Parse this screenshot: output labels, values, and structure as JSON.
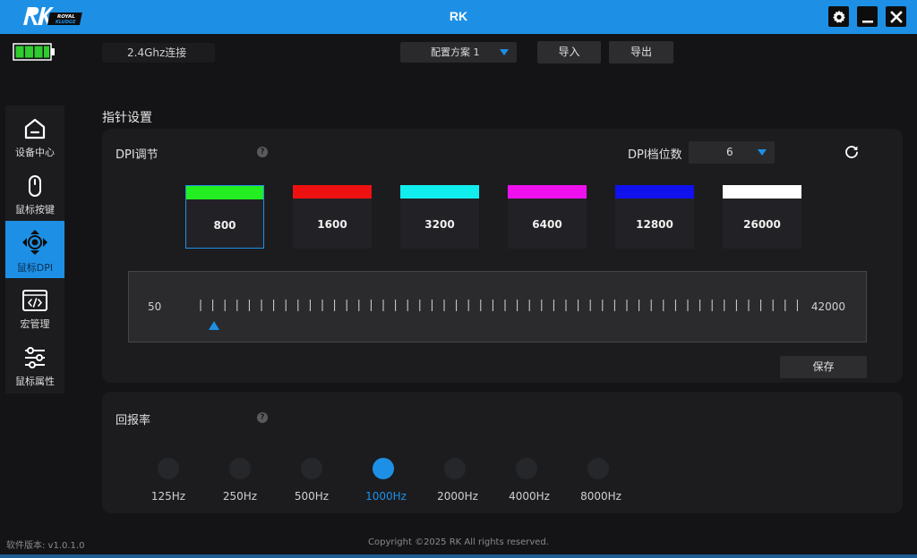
{
  "window": {
    "title": "RK",
    "logo_text": "RK ROYAL KLUDGE",
    "controls": [
      "gear-icon",
      "minimize-icon",
      "close-icon"
    ]
  },
  "topbar": {
    "battery_color": "#2ecc2e",
    "connection": "2.4Ghz连接",
    "profile": "配置方案  1",
    "import_label": "导入",
    "export_label": "导出"
  },
  "sidebar": {
    "items": [
      {
        "label": "设备中心",
        "icon": "home-icon",
        "active": false
      },
      {
        "label": "鼠标按键",
        "icon": "mouse-icon",
        "active": false
      },
      {
        "label": "鼠标DPI",
        "icon": "dpi-icon",
        "active": true
      },
      {
        "label": "宏管理",
        "icon": "macro-icon",
        "active": false
      },
      {
        "label": "鼠标属性",
        "icon": "sliders-icon",
        "active": false
      }
    ]
  },
  "section": {
    "title": "指针设置"
  },
  "dpi": {
    "label": "DPI调节",
    "help": "?",
    "levels_label": "DPI档位数",
    "levels_value": "6",
    "stages": [
      {
        "value": "800",
        "color": "#22ee22",
        "selected": true
      },
      {
        "value": "1600",
        "color": "#ee1111",
        "selected": false
      },
      {
        "value": "3200",
        "color": "#11eeee",
        "selected": false
      },
      {
        "value": "6400",
        "color": "#ee11ee",
        "selected": false
      },
      {
        "value": "12800",
        "color": "#1111ee",
        "selected": false
      },
      {
        "value": "26000",
        "color": "#ffffff",
        "selected": false
      }
    ],
    "slider": {
      "min": "50",
      "max": "42000",
      "current": 800
    },
    "save_label": "保存"
  },
  "polling": {
    "label": "回报率",
    "help": "?",
    "rates": [
      {
        "label": "125Hz",
        "selected": false
      },
      {
        "label": "250Hz",
        "selected": false
      },
      {
        "label": "500Hz",
        "selected": false
      },
      {
        "label": "1000Hz",
        "selected": true
      },
      {
        "label": "2000Hz",
        "selected": false
      },
      {
        "label": "4000Hz",
        "selected": false
      },
      {
        "label": "8000Hz",
        "selected": false
      }
    ]
  },
  "footer": {
    "version": "软件版本: v1.0.1.0",
    "copyright": "Copyright ©2025 RK All rights reserved."
  },
  "colors": {
    "accent": "#1d90e6"
  }
}
